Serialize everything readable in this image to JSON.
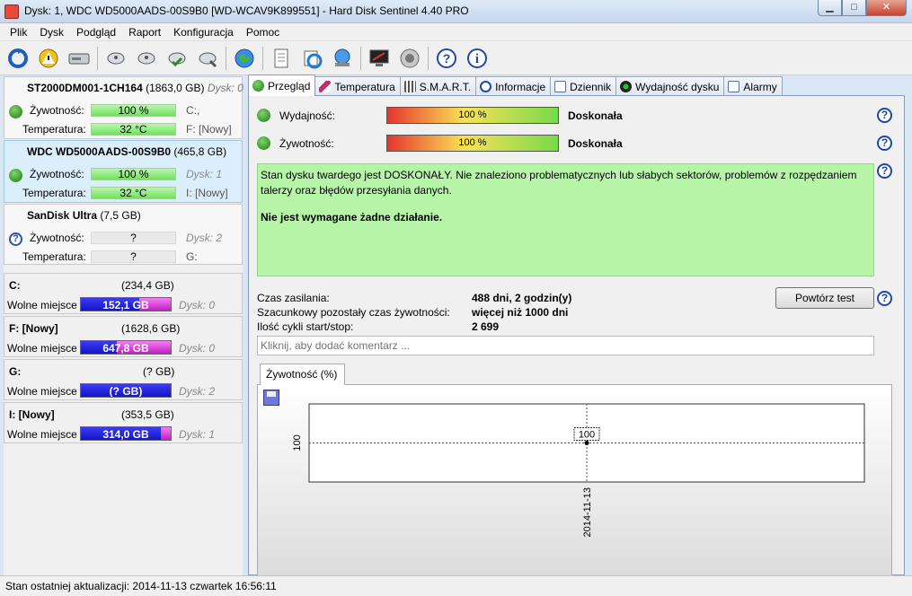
{
  "window": {
    "title": "Dysk: 1, WDC WD5000AADS-00S9B0 [WD-WCAV9K899551]  -  Hard Disk Sentinel 4.40 PRO",
    "minimize": "▁",
    "maximize": "□",
    "close": "✕"
  },
  "menu": [
    {
      "label": "Plik"
    },
    {
      "label": "Dysk"
    },
    {
      "label": "Podgląd"
    },
    {
      "label": "Raport"
    },
    {
      "label": "Konfiguracja"
    },
    {
      "label": "Pomoc"
    }
  ],
  "disks": [
    {
      "name": "ST2000DM001-1CH164",
      "size": "(1863,0 GB)",
      "disk": "Dysk: 0",
      "health_label": "Żywotność:",
      "health": "100 %",
      "health_pct": 100,
      "temp_label": "Temperatura:",
      "temp": "32 °C",
      "letters1": "C:,",
      "letters2": "F: [Nowy]",
      "status": "ok"
    },
    {
      "name": "WDC WD5000AADS-00S9B0",
      "size": "(465,8 GB)",
      "disk": "Dysk: 1",
      "health_label": "Żywotność:",
      "health": "100 %",
      "health_pct": 100,
      "temp_label": "Temperatura:",
      "temp": "32 °C",
      "letters1": "Dysk: 1",
      "letters2": "I: [Nowy]",
      "status": "ok"
    },
    {
      "name": "SanDisk Ultra",
      "size": "(7,5 GB)",
      "disk": "Dysk: 2",
      "health_label": "Żywotność:",
      "health": "?",
      "temp_label": "Temperatura:",
      "temp": "?",
      "letters1": "Dysk: 2",
      "letters2": "G:",
      "status": "unknown"
    }
  ],
  "volumes": [
    {
      "name": "C:",
      "size": "(234,4 GB)",
      "free_label": "Wolne miejsce",
      "free": "152,1 GB",
      "free_pct": 65,
      "disk": "Dysk: 0"
    },
    {
      "name": "F: [Nowy]",
      "size": "(1628,6 GB)",
      "free_label": "Wolne miejsce",
      "free": "647,8 GB",
      "free_pct": 40,
      "disk": "Dysk: 0"
    },
    {
      "name": "G:",
      "size": "(? GB)",
      "free_label": "Wolne miejsce",
      "free": "(? GB)",
      "free_pct": 100,
      "disk": "Dysk: 2"
    },
    {
      "name": "I: [Nowy]",
      "size": "(353,5 GB)",
      "free_label": "Wolne miejsce",
      "free": "314,0 GB",
      "free_pct": 89,
      "disk": "Dysk: 1"
    }
  ],
  "tabs": [
    {
      "label": "Przegląd",
      "icon": "check-icon",
      "active": true
    },
    {
      "label": "Temperatura",
      "icon": "thermometer-icon"
    },
    {
      "label": "S.M.A.R.T.",
      "icon": "smart-icon"
    },
    {
      "label": "Informacje",
      "icon": "info-icon"
    },
    {
      "label": "Dziennik",
      "icon": "log-icon"
    },
    {
      "label": "Wydajność dysku",
      "icon": "gauge-icon"
    },
    {
      "label": "Alarmy",
      "icon": "alarm-icon"
    }
  ],
  "overview": {
    "performance_label": "Wydajność:",
    "performance": "100 %",
    "performance_pct": 100,
    "performance_rating": "Doskonała",
    "health_label": "Żywotność:",
    "health": "100 %",
    "health_pct": 100,
    "health_rating": "Doskonała",
    "status_text": "Stan dysku twardego jest DOSKONAŁY. Nie znaleziono problematycznych lub słabych sektorów, problemów z rozpędzaniem talerzy oraz błędów przesyłania danych.",
    "action_text": "Nie jest wymagane żadne działanie.",
    "power_on_label": "Czas zasilania:",
    "power_on": "488 dni, 2 godzin(y)",
    "lifetime_label": "Szacunkowy pozostały czas żywotności:",
    "lifetime": "więcej niż 1000 dni",
    "cycles_label": "Ilość cykli start/stop:",
    "cycles": "2 699",
    "retest_button": "Powtórz test",
    "comment_placeholder": "Kliknij, aby dodać komentarz ...",
    "chart_tab": "Żywotność (%)"
  },
  "chart_data": {
    "type": "line",
    "x": [
      "2014-11-13"
    ],
    "series": [
      {
        "values": [
          100
        ]
      }
    ],
    "point_label": "100",
    "ytick": "100"
  },
  "statusbar": {
    "text": "Stan ostatniej aktualizacji: 2014-11-13 czwartek 16:56:11"
  },
  "colors": {
    "ok": "#2a8a1c",
    "status_bg": "#b6f5a8",
    "free_space": "#1414c8",
    "used_space": "#c41cc4"
  }
}
